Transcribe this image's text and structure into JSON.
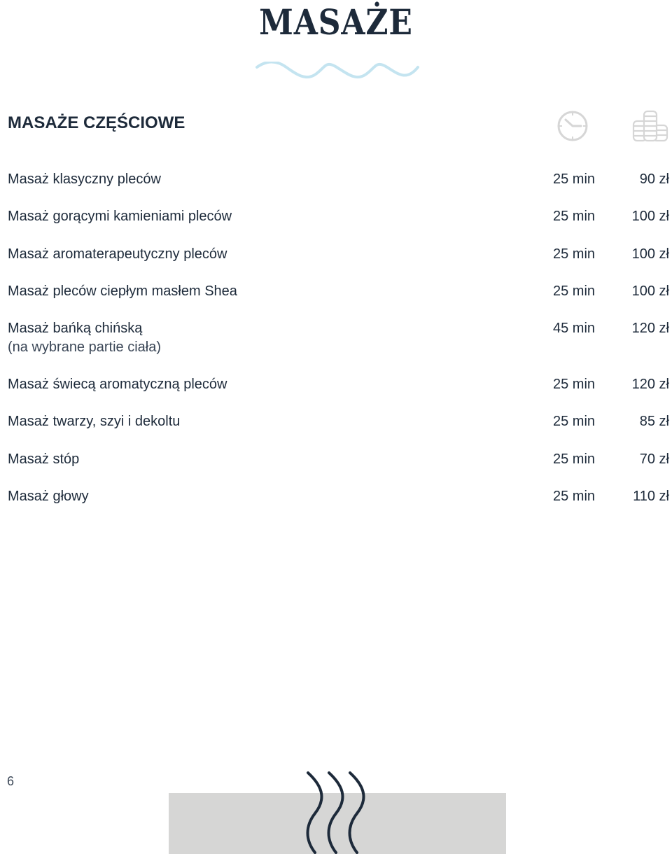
{
  "colors": {
    "accent": "#1d2a3a",
    "wave": "#c4e4f0",
    "icon": "#d6d6d6",
    "block": "#d6d6d5"
  },
  "page": {
    "title": "MASAŻE",
    "number": "6"
  },
  "section": {
    "heading": "MASAŻE CZĘŚCIOWE",
    "time_icon": "clock-icon",
    "price_icon": "coins-icon"
  },
  "services": [
    {
      "name": "Masaż klasyczny pleców",
      "note": "",
      "time": "25 min",
      "price": "90 zł"
    },
    {
      "name": "Masaż gorącymi kamieniami pleców",
      "note": "",
      "time": "25 min",
      "price": "100 zł"
    },
    {
      "name": "Masaż aromaterapeutyczny pleców",
      "note": "",
      "time": "25 min",
      "price": "100 zł"
    },
    {
      "name": "Masaż pleców ciepłym masłem Shea",
      "note": "",
      "time": "25 min",
      "price": "100 zł"
    },
    {
      "name": "Masaż bańką chińską",
      "note": "(na wybrane partie ciała)",
      "time": "45 min",
      "price": "120 zł"
    },
    {
      "name": "Masaż świecą aromatyczną pleców",
      "note": "",
      "time": "25 min",
      "price": "120 zł"
    },
    {
      "name": "Masaż twarzy, szyi i dekoltu",
      "note": "",
      "time": "25 min",
      "price": "85 zł"
    },
    {
      "name": "Masaż stóp",
      "note": "",
      "time": "25 min",
      "price": "70 zł"
    },
    {
      "name": "Masaż głowy",
      "note": "",
      "time": "25 min",
      "price": "110 zł"
    }
  ]
}
